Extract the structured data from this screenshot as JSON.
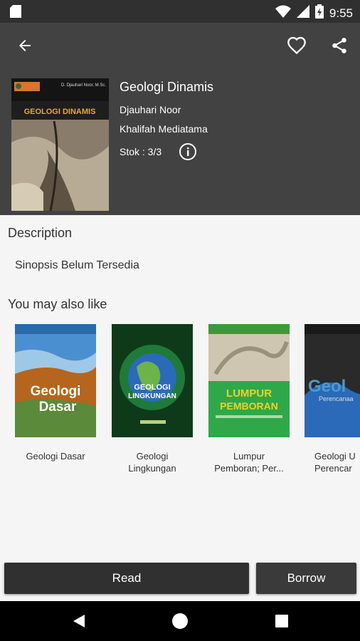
{
  "status_bar": {
    "time": "9:55",
    "icons": [
      "sd-card-icon",
      "wifi-icon",
      "signal-icon",
      "battery-icon"
    ]
  },
  "header": {
    "icons": {
      "back": "arrow-left-icon",
      "favorite": "heart-outline-icon",
      "share": "share-icon"
    }
  },
  "book": {
    "title": "Geologi Dinamis",
    "author": "Djauhari Noor",
    "publisher": "Khalifah Mediatama",
    "stock": "Stok : 3/3",
    "cover": {
      "author_line": "D. Djauhari Noor, M.Sc.",
      "title": "GEOLOGI DINAMIS"
    }
  },
  "description": {
    "heading": "Description",
    "text": "Sinopsis Belum Tersedia"
  },
  "recommendations": {
    "heading": "You may also like",
    "items": [
      {
        "caption": "Geologi Dasar",
        "cover_title": "Geologi\nDasar"
      },
      {
        "caption": "Geologi\nLingkungan",
        "cover_title": "GEOLOGI LINGKUNGAN"
      },
      {
        "caption": "Lumpur\nPemboran; Per...",
        "cover_title": "LUMPUR PEMBORAN"
      },
      {
        "caption": "Geologi U\nPerencar",
        "cover_title": "Geol"
      }
    ]
  },
  "actions": {
    "read": "Read",
    "borrow": "Borrow"
  },
  "nav": {
    "icons": [
      "back-triangle-icon",
      "home-circle-icon",
      "recents-square-icon"
    ]
  },
  "colors": {
    "header_bg": "#424242",
    "status_bg": "#303030",
    "button_bg": "#303030",
    "page_bg": "#f5f5f5"
  }
}
